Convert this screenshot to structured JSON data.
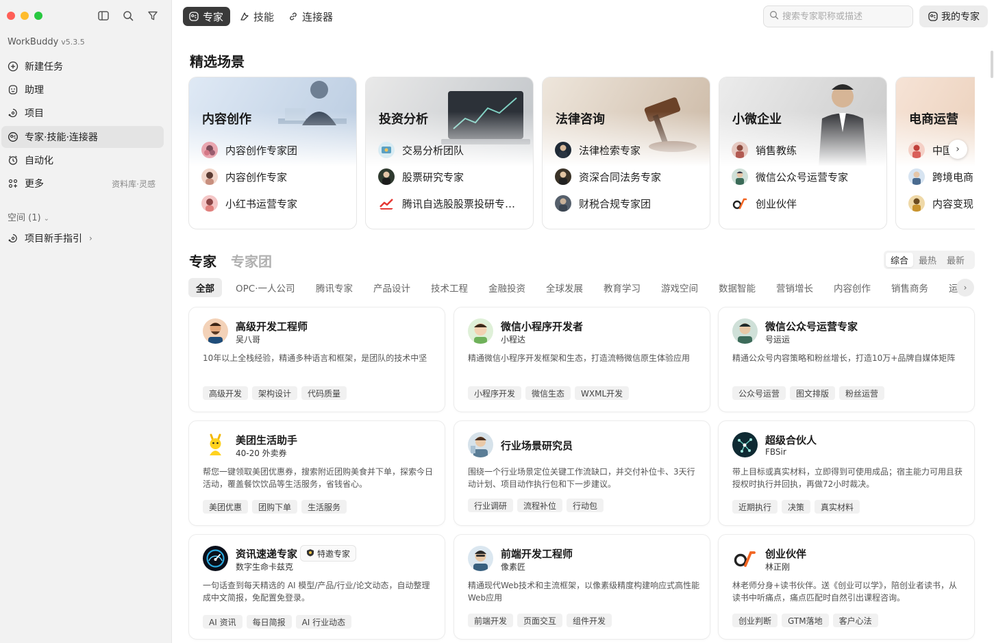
{
  "sidebar": {
    "app_name": "WorkBuddy",
    "version": "v5.3.5",
    "nav": [
      {
        "label": "新建任务",
        "icon": "plus-circle-icon"
      },
      {
        "label": "助理",
        "icon": "assistant-icon"
      },
      {
        "label": "项目",
        "icon": "project-icon"
      },
      {
        "label": "专家·技能·连接器",
        "icon": "expert-icon",
        "active": true
      },
      {
        "label": "自动化",
        "icon": "automation-icon"
      },
      {
        "label": "更多",
        "icon": "grid-icon",
        "extra": "资料库·灵感"
      }
    ],
    "space_label": "空间 (1)",
    "project_guide": "项目新手指引"
  },
  "topbar": {
    "tabs": [
      {
        "label": "专家",
        "icon": "expert-icon",
        "active": true
      },
      {
        "label": "技能",
        "icon": "skill-icon"
      },
      {
        "label": "连接器",
        "icon": "link-icon"
      }
    ],
    "search_placeholder": "搜索专家职称或描述",
    "my_experts": "我的专家"
  },
  "featured": {
    "title": "精选场景",
    "cards": [
      {
        "title": "内容创作",
        "items": [
          "内容创作专家团",
          "内容创作专家",
          "小红书运营专家"
        ]
      },
      {
        "title": "投资分析",
        "items": [
          "交易分析团队",
          "股票研究专家",
          "腾讯自选股股票投研专…"
        ]
      },
      {
        "title": "法律咨询",
        "items": [
          "法律检索专家",
          "资深合同法务专家",
          "财税合规专家团"
        ]
      },
      {
        "title": "小微企业",
        "items": [
          "销售教练",
          "微信公众号运营专家",
          "创业伙伴"
        ]
      },
      {
        "title": "电商运营",
        "items": [
          "中国新",
          "跨境电商",
          "内容变现"
        ]
      }
    ]
  },
  "experts_section": {
    "tab_experts": "专家",
    "tab_teams": "专家团",
    "sort": [
      "综合",
      "最热",
      "最新"
    ],
    "categories": [
      "全部",
      "OPC·一人公司",
      "腾讯专家",
      "产品设计",
      "技术工程",
      "金融投资",
      "全球发展",
      "教育学习",
      "游戏空间",
      "数据智能",
      "营销增长",
      "内容创作",
      "销售商务",
      "运"
    ],
    "cards": [
      {
        "name": "高级开发工程师",
        "author": "吴八哥",
        "desc": "10年以上全栈经验，精通多种语言和框架，是团队的技术中坚",
        "tags": [
          "高级开发",
          "架构设计",
          "代码质量"
        ]
      },
      {
        "name": "微信小程序开发者",
        "author": "小程达",
        "desc": "精通微信小程序开发框架和生态，打造流畅微信原生体验应用",
        "tags": [
          "小程序开发",
          "微信生态",
          "WXML开发"
        ]
      },
      {
        "name": "微信公众号运营专家",
        "author": "号运运",
        "desc": "精通公众号内容策略和粉丝增长，打造10万+品牌自媒体矩阵",
        "tags": [
          "公众号运营",
          "图文排版",
          "粉丝运营"
        ]
      },
      {
        "name": "美团生活助手",
        "author": "40-20 外卖券",
        "desc": "帮您一键领取美团优惠券，搜索附近团购美食并下单，探索今日活动，覆盖餐饮饮品等生活服务，省钱省心。",
        "tags": [
          "美团优惠",
          "团购下单",
          "生活服务"
        ]
      },
      {
        "name": "行业场景研究员",
        "author": "",
        "desc": "围绕一个行业场景定位关键工作流缺口，并交付补位卡、3天行动计划、项目动作执行包和下一步建议。",
        "tags": [
          "行业调研",
          "流程补位",
          "行动包"
        ]
      },
      {
        "name": "超级合伙人",
        "author": "FBSir",
        "desc": "带上目标或真实材料，立即得到可使用成品；宿主能力可用且获授权时执行并回执，再做72小时裁决。",
        "tags": [
          "近期执行",
          "决策",
          "真实材料"
        ]
      },
      {
        "name": "资讯速递专家",
        "author": "数字生命卡兹克",
        "badge": "特邀专家",
        "desc": "一句话查到每天精选的 AI 模型/产品/行业/论文动态，自动整理成中文简报，免配置免登录。",
        "tags": [
          "AI 资讯",
          "每日简报",
          "AI 行业动态"
        ]
      },
      {
        "name": "前端开发工程师",
        "author": "像素匠",
        "desc": "精通现代Web技术和主流框架，以像素级精度构建响应式高性能Web应用",
        "tags": [
          "前端开发",
          "页面交互",
          "组件开发"
        ]
      },
      {
        "name": "创业伙伴",
        "author": "林正刚",
        "desc": "林老师分身+读书伙伴。送《创业可以学》，陪创业者读书，从读书中听痛点，痛点匹配时自然引出课程咨询。",
        "tags": [
          "创业判断",
          "GTM落地",
          "客户心法"
        ]
      }
    ]
  }
}
